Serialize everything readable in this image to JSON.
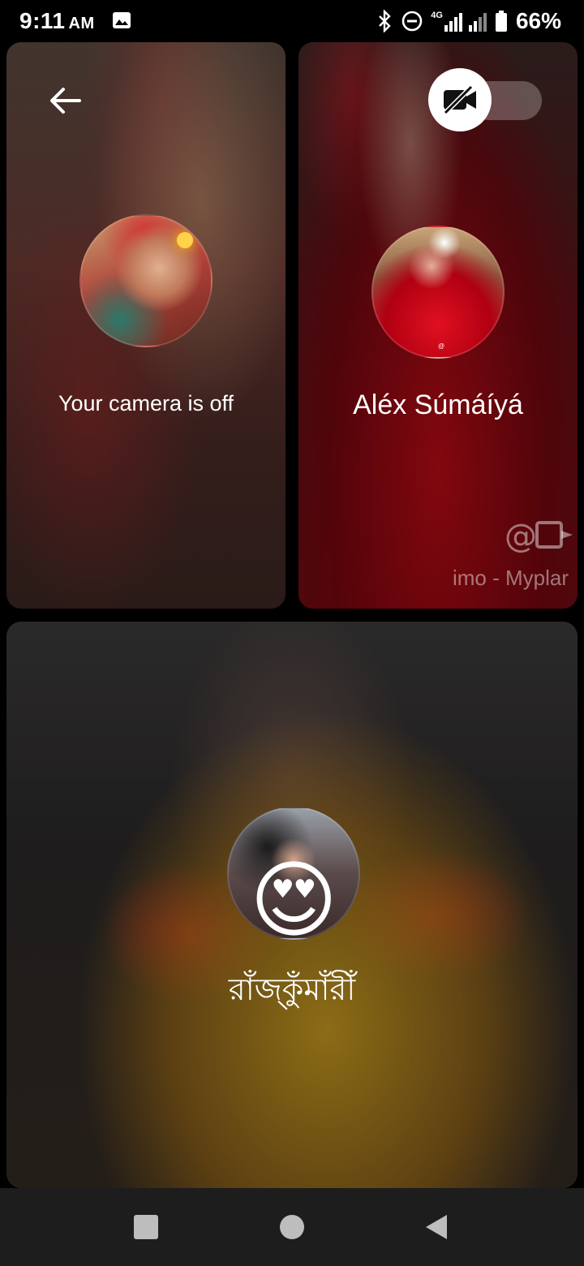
{
  "status_bar": {
    "time": "9:11",
    "ampm": "AM",
    "network": "4G",
    "battery_percent": "66%",
    "icons": [
      "gallery-icon",
      "bluetooth-icon",
      "do-not-disturb-icon",
      "signal-icon",
      "battery-icon"
    ]
  },
  "call": {
    "self_tile": {
      "label": "Your camera is off"
    },
    "participants": [
      {
        "name": "Aléx Súmáíyá",
        "watermark": "imo - Myplar"
      },
      {
        "name": "রাঁজ্কুঁমাঁরীঁ",
        "emoji": "😍"
      }
    ],
    "controls": {
      "back_icon": "arrow-left-icon",
      "camera_toggle_icon": "camera-off-icon",
      "camera_on": false
    }
  },
  "nav_bar": {
    "buttons": [
      "recents",
      "home",
      "back"
    ]
  }
}
